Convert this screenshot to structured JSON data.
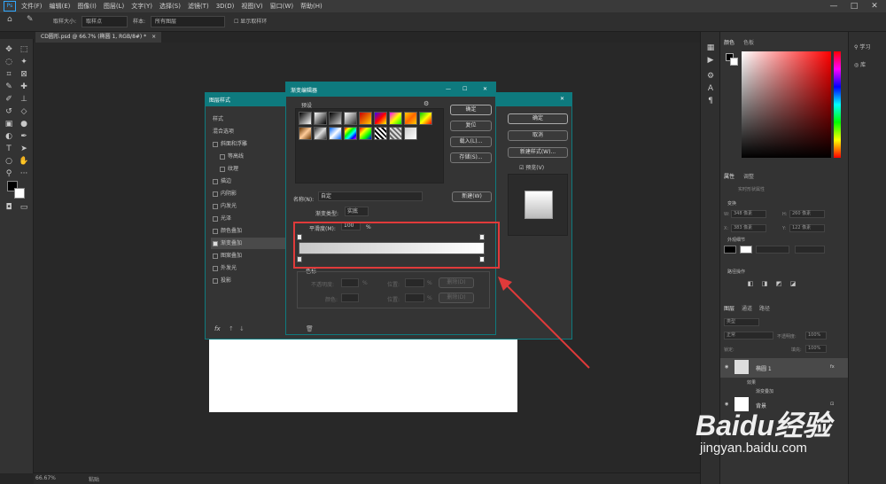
{
  "menubar": {
    "logo": "Ps",
    "items": [
      "文件(F)",
      "编辑(E)",
      "图像(I)",
      "图层(L)",
      "文字(Y)",
      "选择(S)",
      "滤镜(T)",
      "3D(D)",
      "视图(V)",
      "窗口(W)",
      "帮助(H)"
    ],
    "minimize": "—",
    "maximize": "□",
    "close": "✕"
  },
  "options": {
    "sample_size_label": "取样大小:",
    "sample_size_value": "取样点",
    "sample_label": "样本:",
    "sample_value": "所有图层",
    "show_ring": "显示取样环"
  },
  "document": {
    "tab": "CD圆形.psd @ 66.7% (椭圆 1, RGB/8#) *",
    "tab_close": "×"
  },
  "status": {
    "zoom": "66.67%",
    "info": "粘贴"
  },
  "layer_style": {
    "title": "图层样式",
    "close": "✕",
    "items": [
      "样式",
      "混合选项",
      "斜面和浮雕",
      "等高线",
      "纹理",
      "描边",
      "内阴影",
      "内发光",
      "光泽",
      "颜色叠加",
      "渐变叠加",
      "图案叠加",
      "外发光",
      "投影"
    ],
    "checked_index": 10,
    "ok": "确定",
    "cancel": "取消",
    "new_style": "新建样式(W)...",
    "preview": "预览(V)",
    "fx": "fx",
    "up": "↑",
    "down": "↓"
  },
  "gradient_editor": {
    "title": "渐变编辑器",
    "min": "—",
    "max": "☐",
    "close": "✕",
    "presets_label": "预设",
    "presets_gear": "⚙",
    "ok": "确定",
    "reset": "复位",
    "load": "载入(L)...",
    "save": "存储(S)...",
    "name_label": "名称(N):",
    "name_value": "自定",
    "new_button": "新建(W)",
    "type_label": "渐变类型:",
    "type_value": "实底",
    "smooth_label": "平滑度(M):",
    "smooth_value": "100",
    "smooth_unit": "%",
    "stops_label": "色标",
    "opacity_label": "不透明度:",
    "opacity_unit": "%",
    "location_label": "位置:",
    "location_unit": "%",
    "delete": "删除(D)",
    "color_label": "颜色:",
    "location2_label": "位置:",
    "location2_unit": "%",
    "delete2": "删除(D)",
    "trash": "🗑"
  },
  "panels": {
    "color_tabs": [
      "颜色",
      "色板"
    ],
    "learn": "学习",
    "library": "库",
    "properties_tabs": [
      "属性",
      "调整"
    ],
    "shape_props": "实时形状属性",
    "transform": "变换",
    "w_label": "W:",
    "w_value": "348 像素",
    "h_label": "H:",
    "h_value": "260 像素",
    "x_label": "X:",
    "x_value": "383 像素",
    "y_label": "Y:",
    "y_value": "122 像素",
    "appearance": "外观细节",
    "path_ops": "路径操作",
    "layers_tabs": [
      "图层",
      "通道",
      "路径"
    ],
    "kind": "类型",
    "mode": "正常",
    "opacity_label": "不透明度:",
    "opacity_value": "100%",
    "lock_label": "锁定:",
    "fill_label": "填充:",
    "fill_value": "100%",
    "layer1": "椭圆 1",
    "fx": "fx",
    "effects": "效果",
    "effect1": "渐变叠加",
    "bg_layer": "背景"
  },
  "watermark": {
    "brand": "Baidu经验",
    "url": "jingyan.baidu.com"
  },
  "colors": {
    "teal": "#0e7a7e",
    "highlight": "#e03a3a"
  },
  "icons": [
    "home-icon",
    "eyedropper-icon",
    "move-icon",
    "marquee-icon",
    "lasso-icon",
    "wand-icon",
    "crop-icon",
    "frame-icon",
    "eyedropper-tool-icon",
    "heal-icon",
    "brush-icon",
    "stamp-icon",
    "history-brush-icon",
    "eraser-icon",
    "bucket-icon",
    "blur-icon",
    "dodge-icon",
    "pen-icon",
    "type-icon",
    "path-select-icon",
    "shape-icon",
    "hand-icon",
    "zoom-icon"
  ]
}
